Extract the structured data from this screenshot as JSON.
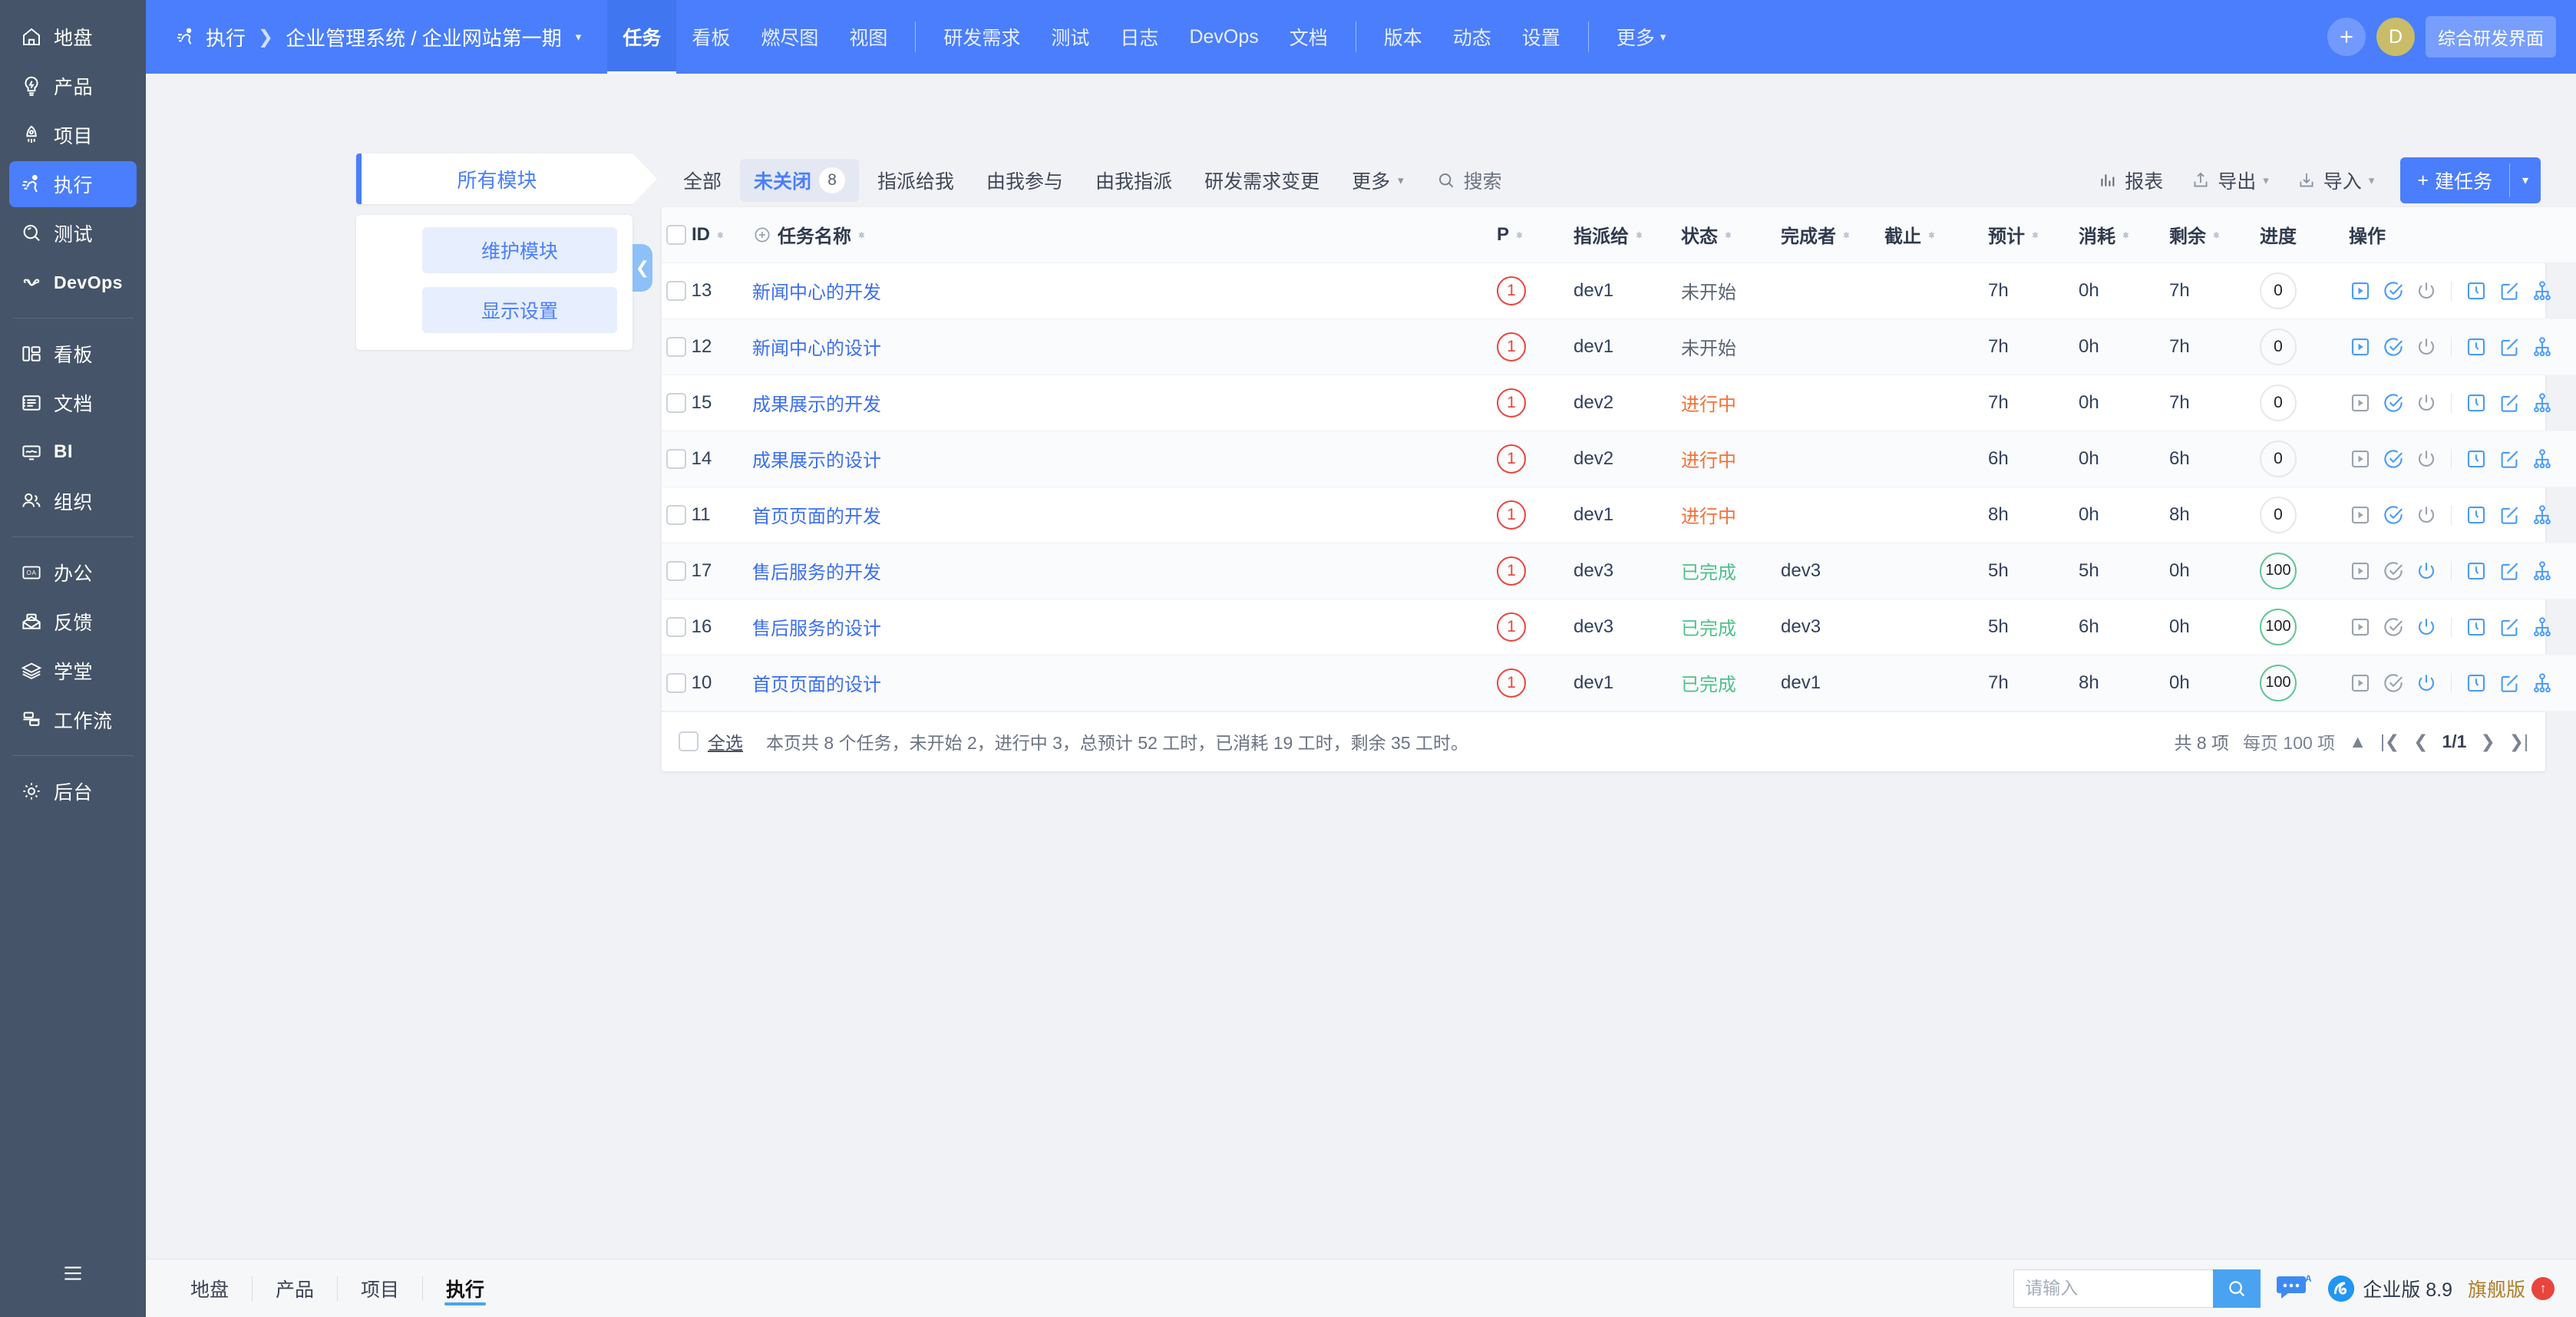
{
  "rail": {
    "groups": [
      {
        "items": [
          {
            "label": "地盘",
            "icon": "home-icon",
            "active": false
          },
          {
            "label": "产品",
            "icon": "bulb-icon",
            "active": false
          },
          {
            "label": "项目",
            "icon": "rocket-icon",
            "active": false
          },
          {
            "label": "执行",
            "icon": "run-icon",
            "active": true
          },
          {
            "label": "测试",
            "icon": "magnifier-icon",
            "active": false
          },
          {
            "label": "DevOps",
            "icon": "infinity-icon",
            "active": false
          }
        ]
      },
      {
        "items": [
          {
            "label": "看板",
            "icon": "kanban-icon",
            "active": false
          },
          {
            "label": "文档",
            "icon": "doc-icon",
            "active": false
          },
          {
            "label": "BI",
            "icon": "bi-icon",
            "active": false
          },
          {
            "label": "组织",
            "icon": "users-icon",
            "active": false
          }
        ]
      },
      {
        "items": [
          {
            "label": "办公",
            "icon": "oa-icon",
            "active": false
          },
          {
            "label": "反馈",
            "icon": "feedback-icon",
            "active": false
          },
          {
            "label": "学堂",
            "icon": "school-icon",
            "active": false
          },
          {
            "label": "工作流",
            "icon": "workflow-icon",
            "active": false
          }
        ]
      },
      {
        "items": [
          {
            "label": "后台",
            "icon": "gear-icon",
            "active": false
          }
        ]
      }
    ],
    "collapse_icon": "menu-collapse-icon"
  },
  "topbar": {
    "breadcrumb": {
      "icon": "run-icon",
      "root": "执行",
      "separator": "❯",
      "path": "企业管理系统 / 企业网站第一期",
      "caret": "▾"
    },
    "nav": [
      {
        "label": "任务",
        "active": true
      },
      {
        "label": "看板",
        "active": false
      },
      {
        "label": "燃尽图",
        "active": false
      },
      {
        "label": "视图",
        "active": false
      },
      {
        "divider": true
      },
      {
        "label": "研发需求",
        "active": false
      },
      {
        "label": "测试",
        "active": false
      },
      {
        "label": "日志",
        "active": false
      },
      {
        "label": "DevOps",
        "active": false
      },
      {
        "label": "文档",
        "active": false
      },
      {
        "divider": true
      },
      {
        "label": "版本",
        "active": false
      },
      {
        "label": "动态",
        "active": false
      },
      {
        "label": "设置",
        "active": false
      },
      {
        "divider": true
      },
      {
        "label": "更多",
        "active": false,
        "caret": "▾"
      }
    ],
    "add_button": "+",
    "avatar_initial": "D",
    "ui_switch": "综合研发界面"
  },
  "module_panel": {
    "tab_label": "所有模块",
    "buttons": [
      {
        "label": "维护模块"
      },
      {
        "label": "显示设置"
      }
    ],
    "collapse_arrow": "❮"
  },
  "filters": {
    "items": [
      {
        "label": "全部",
        "active": false
      },
      {
        "label": "未关闭",
        "active": true,
        "badge": "8"
      },
      {
        "label": "指派给我",
        "active": false
      },
      {
        "label": "由我参与",
        "active": false
      },
      {
        "label": "由我指派",
        "active": false
      },
      {
        "label": "研发需求变更",
        "active": false
      },
      {
        "label": "更多",
        "active": false,
        "caret": "▾"
      }
    ],
    "search_label": "搜索",
    "search_icon": "search-icon",
    "actions": [
      {
        "label": "报表",
        "icon": "chart-icon"
      },
      {
        "label": "导出",
        "icon": "export-icon",
        "caret": "▾"
      },
      {
        "label": "导入",
        "icon": "import-icon",
        "caret": "▾"
      }
    ],
    "create_button": {
      "plus": "+",
      "label": "建任务",
      "caret": "▾"
    }
  },
  "table": {
    "columns": [
      {
        "key": "id",
        "label": "ID",
        "sortable": true
      },
      {
        "key": "name",
        "label": "任务名称",
        "sortable": true,
        "prefix_icon": "expand-plus-icon"
      },
      {
        "key": "p",
        "label": "P",
        "sortable": true
      },
      {
        "key": "assigned",
        "label": "指派给",
        "sortable": true
      },
      {
        "key": "status",
        "label": "状态",
        "sortable": true
      },
      {
        "key": "finisher",
        "label": "完成者",
        "sortable": true
      },
      {
        "key": "deadline",
        "label": "截止",
        "sortable": true
      },
      {
        "key": "estimate",
        "label": "预计",
        "sortable": true
      },
      {
        "key": "consumed",
        "label": "消耗",
        "sortable": true
      },
      {
        "key": "left",
        "label": "剩余",
        "sortable": true
      },
      {
        "key": "progress",
        "label": "进度",
        "sortable": false
      },
      {
        "key": "actions",
        "label": "操作",
        "sortable": false
      },
      {
        "key": "settings",
        "label": "",
        "icon": "gear-icon"
      }
    ],
    "rows": [
      {
        "id": "13",
        "name": "新闻中心的开发",
        "p": "1",
        "assigned": "dev1",
        "status": "未开始",
        "status_kind": "wait",
        "finisher": "",
        "deadline": "",
        "estimate": "7h",
        "consumed": "0h",
        "left": "7h",
        "progress": "0"
      },
      {
        "id": "12",
        "name": "新闻中心的设计",
        "p": "1",
        "assigned": "dev1",
        "status": "未开始",
        "status_kind": "wait",
        "finisher": "",
        "deadline": "",
        "estimate": "7h",
        "consumed": "0h",
        "left": "7h",
        "progress": "0"
      },
      {
        "id": "15",
        "name": "成果展示的开发",
        "p": "1",
        "assigned": "dev2",
        "status": "进行中",
        "status_kind": "doing",
        "finisher": "",
        "deadline": "",
        "estimate": "7h",
        "consumed": "0h",
        "left": "7h",
        "progress": "0"
      },
      {
        "id": "14",
        "name": "成果展示的设计",
        "p": "1",
        "assigned": "dev2",
        "status": "进行中",
        "status_kind": "doing",
        "finisher": "",
        "deadline": "",
        "estimate": "6h",
        "consumed": "0h",
        "left": "6h",
        "progress": "0"
      },
      {
        "id": "11",
        "name": "首页页面的开发",
        "p": "1",
        "assigned": "dev1",
        "status": "进行中",
        "status_kind": "doing",
        "finisher": "",
        "deadline": "",
        "estimate": "8h",
        "consumed": "0h",
        "left": "8h",
        "progress": "0"
      },
      {
        "id": "17",
        "name": "售后服务的开发",
        "p": "1",
        "assigned": "dev3",
        "status": "已完成",
        "status_kind": "done",
        "finisher": "dev3",
        "deadline": "",
        "estimate": "5h",
        "consumed": "5h",
        "left": "0h",
        "progress": "100"
      },
      {
        "id": "16",
        "name": "售后服务的设计",
        "p": "1",
        "assigned": "dev3",
        "status": "已完成",
        "status_kind": "done",
        "finisher": "dev3",
        "deadline": "",
        "estimate": "5h",
        "consumed": "6h",
        "left": "0h",
        "progress": "100"
      },
      {
        "id": "10",
        "name": "首页页面的设计",
        "p": "1",
        "assigned": "dev1",
        "status": "已完成",
        "status_kind": "done",
        "finisher": "dev1",
        "deadline": "",
        "estimate": "7h",
        "consumed": "8h",
        "left": "0h",
        "progress": "100"
      }
    ],
    "row_action_icons": [
      "play-icon",
      "check-circle-icon",
      "power-icon",
      "clock-icon",
      "edit-icon",
      "split-branch-icon"
    ],
    "footer": {
      "select_all": "全选",
      "summary": "本页共 8 个任务，未开始 2，进行中 3，总预计 52 工时，已消耗 19 工时，剩余 35 工时。",
      "total": "共 8 项",
      "per_page": "每页 100 项",
      "per_page_caret": "▲",
      "first": "|❮",
      "prev": "❮",
      "page": "1/1",
      "next": "❯",
      "last": "❯|"
    }
  },
  "bottombar": {
    "tabs": [
      {
        "label": "地盘",
        "active": false
      },
      {
        "label": "产品",
        "active": false
      },
      {
        "label": "项目",
        "active": false
      },
      {
        "label": "执行",
        "active": true
      }
    ],
    "search_placeholder": "请输入",
    "search_icon": "search-icon",
    "ai_icon": "ai-chat-icon",
    "brand_icon": "zentao-logo-icon",
    "version": "企业版 8.9",
    "edition": "旗舰版",
    "upgrade_icon": "upgrade-arrow-icon"
  },
  "colors": {
    "brand": "#4a7efc",
    "rail": "#455468",
    "doing": "#f1713a",
    "done": "#4fc08d",
    "priority": "#e8453c"
  }
}
